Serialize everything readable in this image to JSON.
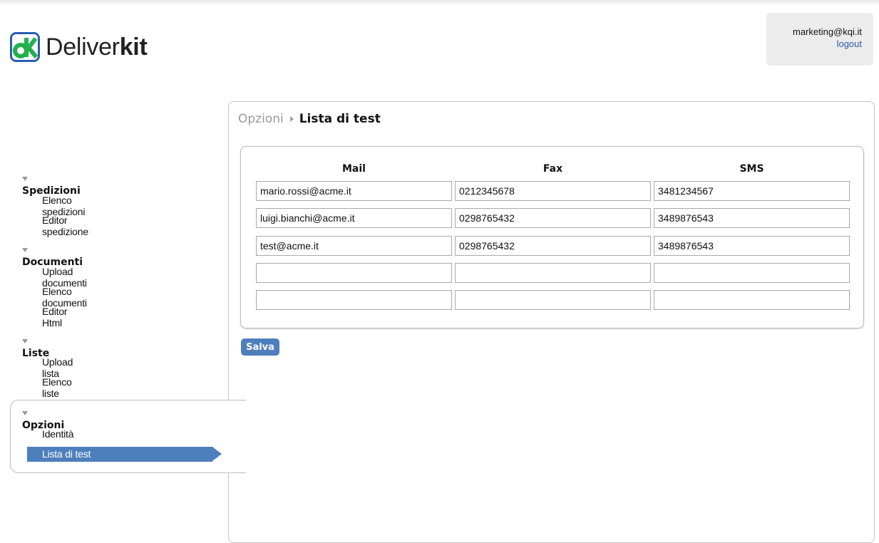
{
  "brand": {
    "name_regular": "Deliver",
    "name_bold": "kit",
    "colors": {
      "logo_green": "#22b14c",
      "logo_blue": "#2a5db0"
    }
  },
  "user": {
    "email": "marketing@kqi.it",
    "logout_label": "logout"
  },
  "sidebar": {
    "sections": [
      {
        "title": "Spedizioni",
        "items": [
          "Elenco spedizioni",
          "Editor spedizione"
        ]
      },
      {
        "title": "Documenti",
        "items": [
          "Upload documenti",
          "Elenco documenti",
          "Editor Html"
        ]
      },
      {
        "title": "Liste",
        "items": [
          "Upload lista",
          "Elenco liste"
        ]
      },
      {
        "title": "Opzioni",
        "items": [
          "Identità",
          "Lista di test"
        ]
      }
    ],
    "active_item": "Lista di test",
    "active_color": "#4e7fbd"
  },
  "breadcrumb": {
    "parent": "Opzioni",
    "current": "Lista di test"
  },
  "table": {
    "headers": [
      "Mail",
      "Fax",
      "SMS"
    ],
    "rows": [
      [
        "mario.rossi@acme.it",
        "0212345678",
        "3481234567"
      ],
      [
        "luigi.bianchi@acme.it",
        "0298765432",
        "3489876543"
      ],
      [
        "test@acme.it",
        "0298765432",
        "3489876543"
      ],
      [
        "",
        "",
        ""
      ],
      [
        "",
        "",
        ""
      ]
    ]
  },
  "actions": {
    "save_label": "Salva"
  }
}
